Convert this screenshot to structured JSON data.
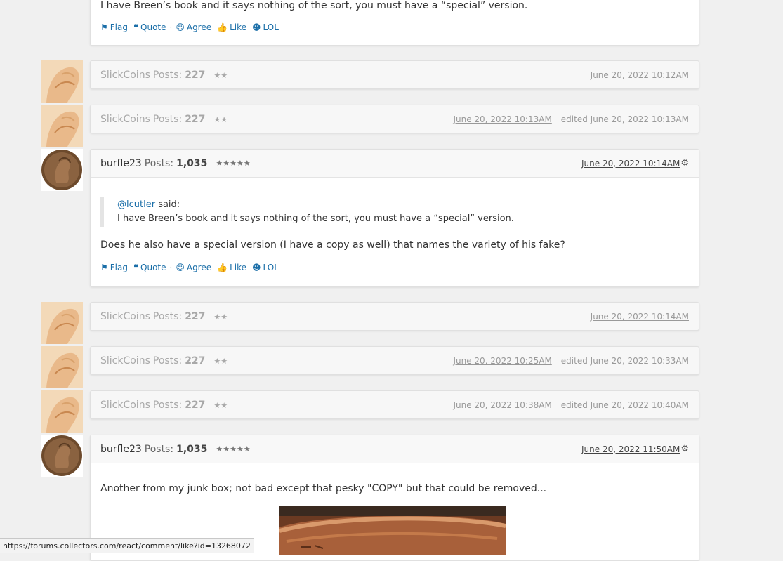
{
  "top_post": {
    "text": "I have Breen’s book and it says nothing of the sort, you must have a “special” version."
  },
  "actions": {
    "flag": "Flag",
    "quote": "Quote",
    "agree": "Agree",
    "like": "Like",
    "lol": "LOL",
    "separator": "·"
  },
  "posts_label": "Posts:",
  "collapsed": [
    {
      "user": "SlickCoins",
      "posts": "227",
      "stars": "★★",
      "date": "June 20, 2022 10:12AM",
      "edited": ""
    },
    {
      "user": "SlickCoins",
      "posts": "227",
      "stars": "★★",
      "date": "June 20, 2022 10:13AM",
      "edited": "edited June 20, 2022 10:13AM"
    },
    {
      "user": "SlickCoins",
      "posts": "227",
      "stars": "★★",
      "date": "June 20, 2022 10:14AM",
      "edited": ""
    },
    {
      "user": "SlickCoins",
      "posts": "227",
      "stars": "★★",
      "date": "June 20, 2022 10:25AM",
      "edited": "edited June 20, 2022 10:33AM"
    },
    {
      "user": "SlickCoins",
      "posts": "227",
      "stars": "★★",
      "date": "June 20, 2022 10:38AM",
      "edited": "edited June 20, 2022 10:40AM"
    }
  ],
  "post1": {
    "user": "burfle23",
    "posts": "1,035",
    "stars": "★★★★★",
    "date": "June 20, 2022 10:14AM",
    "quote_mention": "@lcutler",
    "quote_said": " said:",
    "quote_text": "I have Breen’s book and it says nothing of the sort, you must have a “special” version.",
    "text": "Does he also have a special version (I have a copy as well) that names the variety of his fake?"
  },
  "post2": {
    "user": "burfle23",
    "posts": "1,035",
    "stars": "★★★★★",
    "date": "June 20, 2022 11:50AM",
    "text": "Another from my junk box; not bad except that pesky \"COPY\" but that could be removed..."
  },
  "status_url": "https://forums.collectors.com/react/comment/like?id=13268072",
  "icons": {
    "flag": "flag-icon",
    "quote": "quote-icon",
    "agree": "smile-icon",
    "like": "thumbs-up-icon",
    "lol": "laugh-icon",
    "gear": "gear-icon"
  }
}
